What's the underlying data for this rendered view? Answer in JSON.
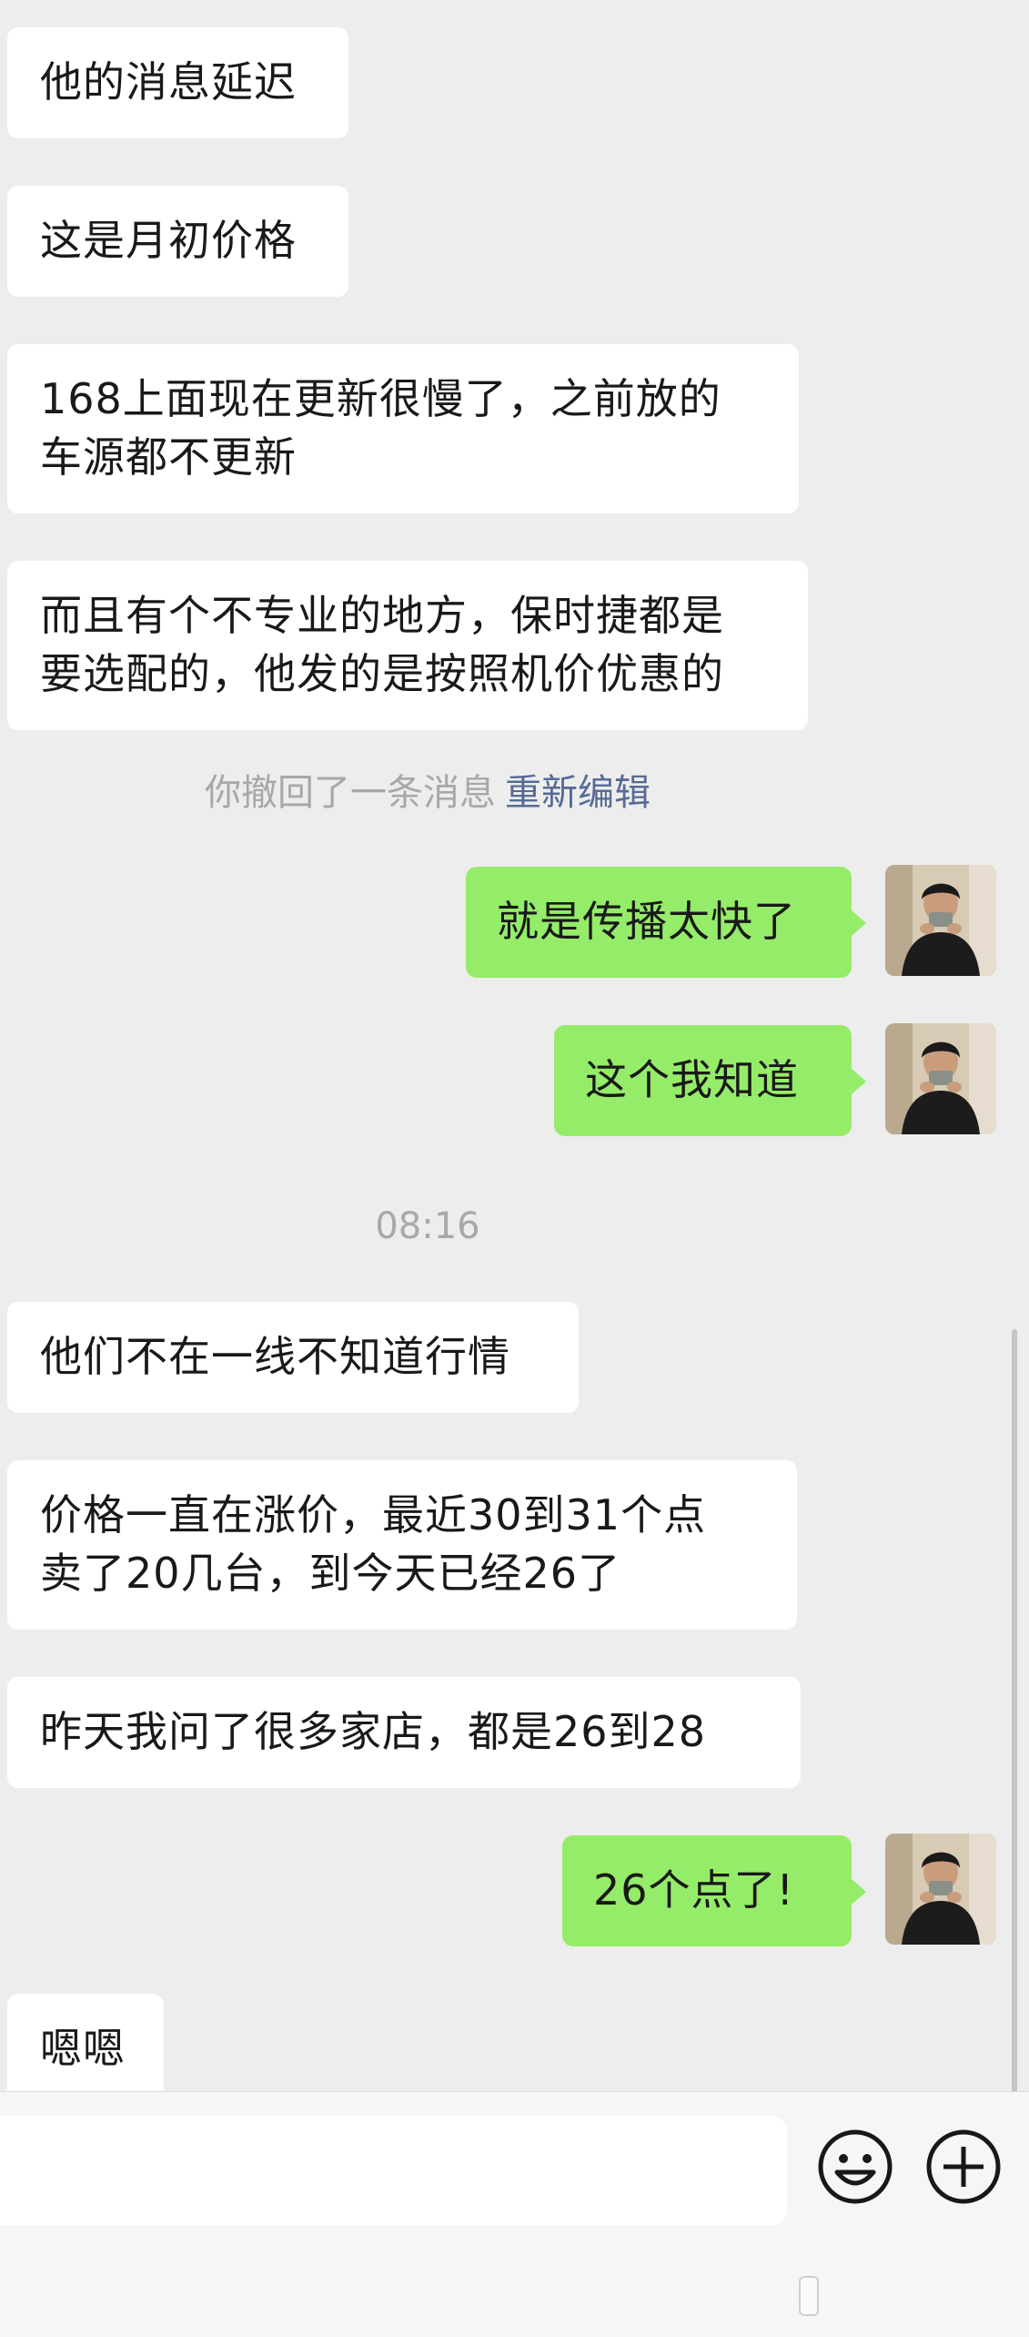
{
  "messages": {
    "m1": "他的消息延迟",
    "m2": "这是月初价格",
    "m3": "168上面现在更新很慢了，之前放的\n车源都不更新",
    "m4": "而且有个不专业的地方，保时捷都是\n要选配的，他发的是按照机价优惠的",
    "m5": "就是传播太快了",
    "m6": "这个我知道",
    "m7": "他们不在一线不知道行情",
    "m8": "价格一直在涨价，最近30到31个点\n卖了20几台，到今天已经26了",
    "m9": "昨天我问了很多家店，都是26到28",
    "m10": "26个点了!",
    "m11": "嗯嗯"
  },
  "system": {
    "recall_text": "你撤回了一条消息",
    "reedit_link": "重新编辑",
    "timestamp": "08:16"
  },
  "input_bar": {
    "emoji_icon": "emoji-icon",
    "plus_icon": "plus-icon"
  },
  "colors": {
    "background": "#ededed",
    "incoming_bubble": "#ffffff",
    "outgoing_bubble": "#95ec69",
    "link": "#576b95",
    "system_text": "#a8a8a8"
  }
}
